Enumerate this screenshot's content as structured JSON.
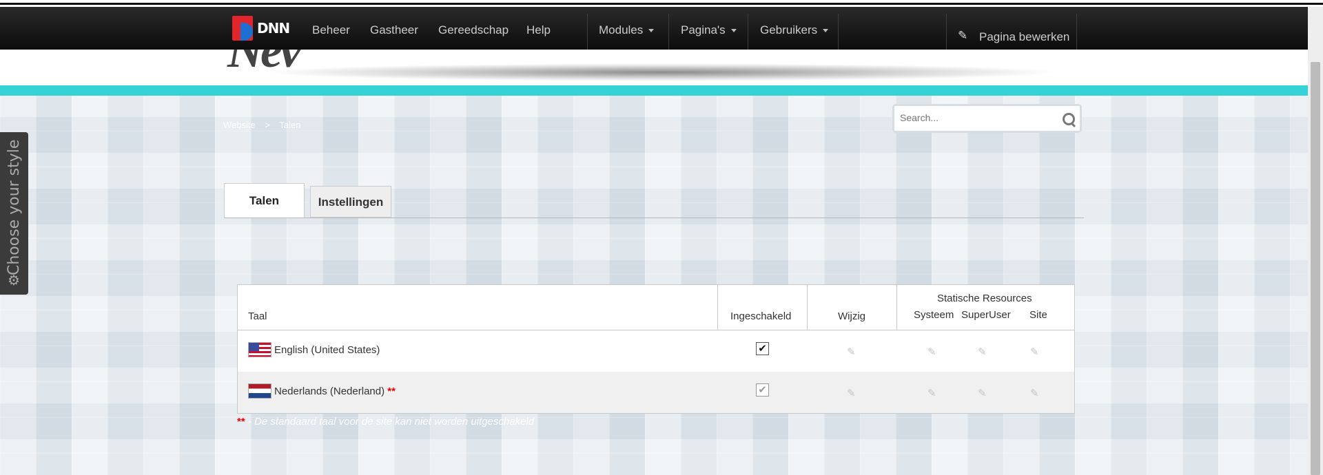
{
  "controlbar": {
    "logo_text": "DNN",
    "nav": [
      "Beheer",
      "Gastheer",
      "Gereedschap",
      "Help"
    ],
    "menus": [
      "Modules",
      "Pagina's",
      "Gebruikers"
    ],
    "edit_page_label": "Pagina bewerken"
  },
  "breadcrumb": [
    "Website",
    ">",
    "Talen"
  ],
  "search": {
    "placeholder": "Search..."
  },
  "tabs": [
    "Talen",
    "Instellingen"
  ],
  "grid": {
    "headers": {
      "language": "Taal",
      "enabled": "Ingeschakeld",
      "edit": "Wijzig",
      "static_resources": "Statische Resources",
      "system": "Systeem",
      "superuser": "SuperUser",
      "site": "Site"
    },
    "rows": [
      {
        "language": "English (United States)",
        "flag": "us",
        "enabled": true,
        "default_marker": ""
      },
      {
        "language": "Nederlands (Nederland)",
        "flag": "nl",
        "enabled": true,
        "default_marker": "**"
      }
    ]
  },
  "footnote": {
    "marker": "**",
    "text": " - De standaard taal voor de site kan niet worden uitgeschakeld"
  },
  "side_panel": {
    "label": "Choose your style"
  },
  "colors": {
    "accent": "#35d3d5",
    "required": "#ee0000",
    "controlbar": "#111111"
  }
}
